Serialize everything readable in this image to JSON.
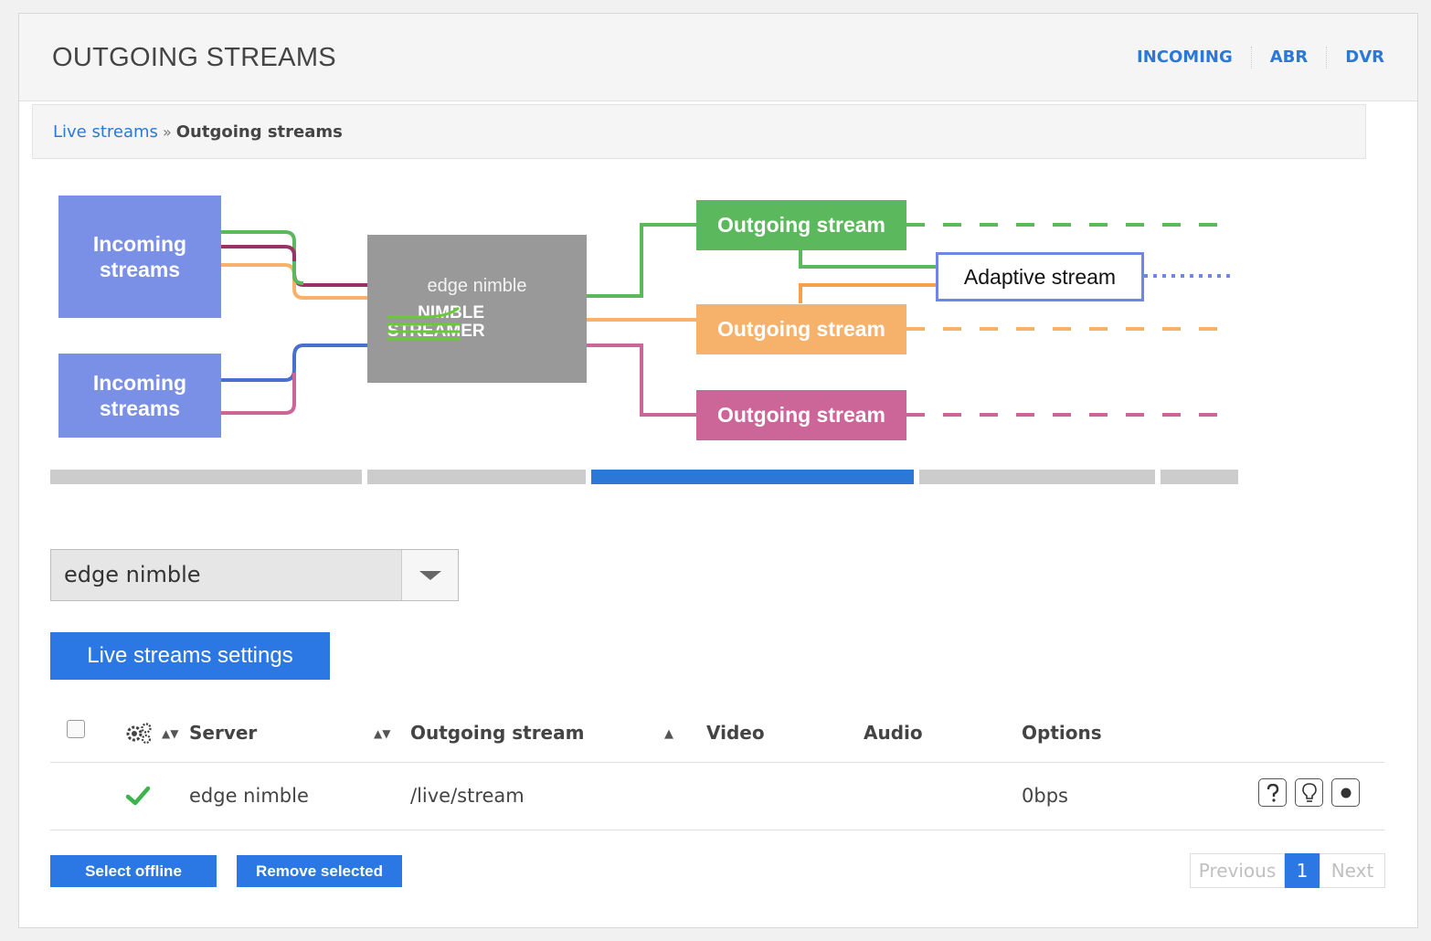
{
  "header": {
    "title": "OUTGOING STREAMS",
    "nav": [
      "INCOMING",
      "ABR",
      "DVR"
    ]
  },
  "breadcrumb": {
    "parent": "Live streams",
    "separator": "»",
    "current": "Outgoing streams"
  },
  "diagram": {
    "incoming_label": "Incoming streams",
    "server_label": "edge nimble",
    "logo_line1": "NIMBLE",
    "logo_line2": "STREAMER",
    "outgoing_label": "Outgoing stream",
    "adaptive_label": "Adaptive stream",
    "colors": {
      "blue": "#7a90e6",
      "green": "#5cb85c",
      "orange": "#f6b26b",
      "pink": "#cc6699",
      "gray": "#999999"
    }
  },
  "progress": {
    "active_step": 3,
    "total_steps": 5
  },
  "server_select": {
    "value": "edge nimble"
  },
  "settings_button": "Live streams settings",
  "table": {
    "columns": {
      "server": "Server",
      "outgoing": "Outgoing stream",
      "video": "Video",
      "audio": "Audio",
      "options": "Options"
    },
    "rows": [
      {
        "server": "edge nimble",
        "outgoing": "/live/stream",
        "video": "",
        "audio": "",
        "options": "0bps"
      }
    ]
  },
  "buttons": {
    "select_offline": "Select offline",
    "remove_selected": "Remove selected"
  },
  "pagination": {
    "previous": "Previous",
    "page": "1",
    "next": "Next"
  },
  "accent": "#2b78e4"
}
